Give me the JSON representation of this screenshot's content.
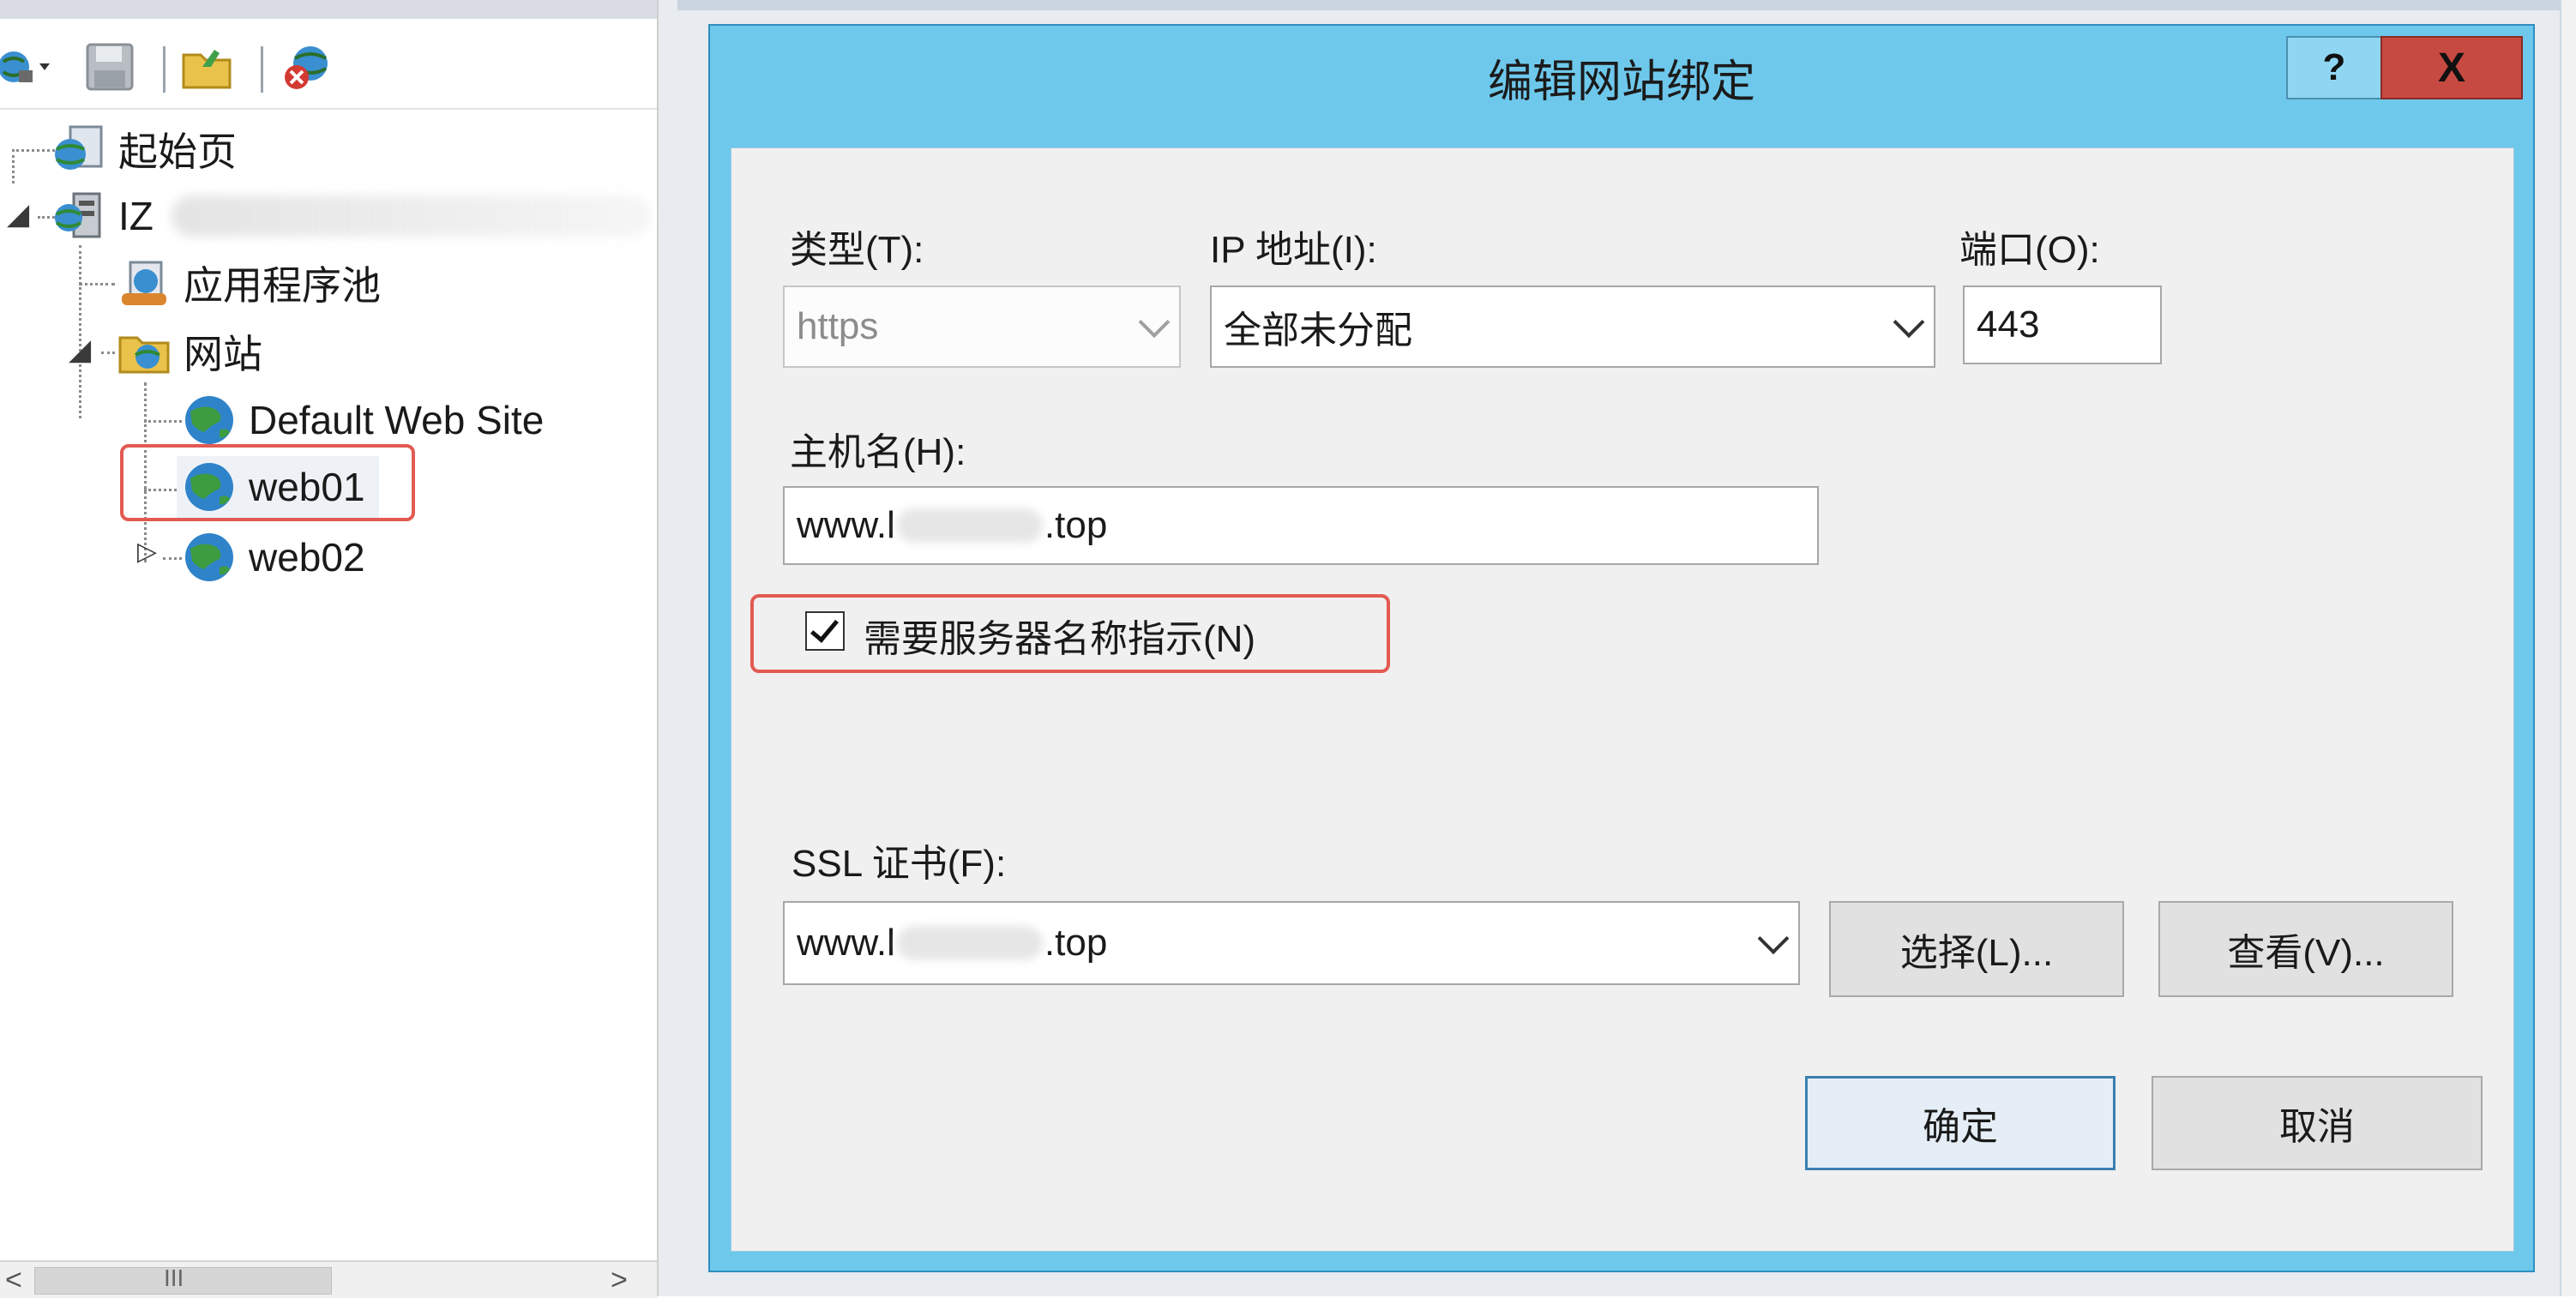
{
  "tree": {
    "start_page": "起始页",
    "server_prefix": "IZ",
    "app_pools": "应用程序池",
    "sites": "网站",
    "default_site": "Default Web Site",
    "site1": "web01",
    "site2": "web02"
  },
  "scrollbar": {
    "thumb_glyph": "III",
    "arrow_left": "<",
    "arrow_right": ">"
  },
  "dialog": {
    "title": "编辑网站绑定",
    "help_label": "?",
    "close_label": "X",
    "type_label": "类型(T):",
    "type_value": "https",
    "ip_label": "IP 地址(I):",
    "ip_value": "全部未分配",
    "port_label": "端口(O):",
    "port_value": "443",
    "host_label": "主机名(H):",
    "host_prefix": "www.l",
    "host_suffix": ".top",
    "sni_label": "需要服务器名称指示(N)",
    "sni_checked": true,
    "ssl_label": "SSL 证书(F):",
    "ssl_prefix": "www.l",
    "ssl_suffix": ".top",
    "select_button": "选择(L)...",
    "view_button": "查看(V)...",
    "ok_button": "确定",
    "cancel_button": "取消"
  },
  "colors": {
    "title_bar": "#6ec8ec",
    "close_button": "#c74a42",
    "highlight": "#e35a52"
  }
}
